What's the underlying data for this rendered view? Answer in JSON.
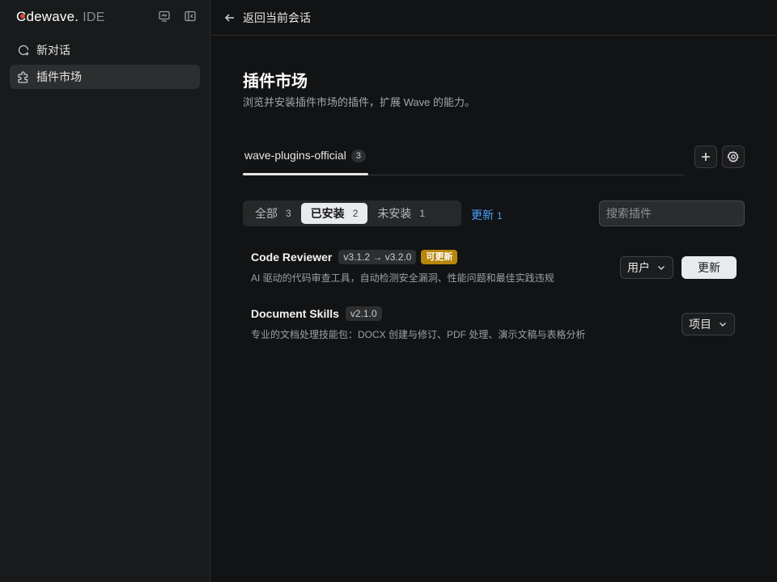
{
  "app": {
    "brand_first": "C",
    "brand_rest": "dewave.",
    "brand_suffix": "IDE",
    "accent_color": "#e0463b"
  },
  "sidebar": {
    "items": [
      {
        "label": "新对话",
        "icon": "new-chat-icon"
      },
      {
        "label": "插件市场",
        "icon": "plugin-icon"
      }
    ]
  },
  "topbar": {
    "back_label": "返回当前会话"
  },
  "main": {
    "title": "插件市场",
    "subtitle": "浏览并安装插件市场的插件，扩展 Wave 的能力。",
    "marketplace_tab": {
      "label": "wave-plugins-official",
      "count": "3"
    },
    "filters": [
      {
        "label": "全部",
        "count": "3"
      },
      {
        "label": "已安装",
        "count": "2"
      },
      {
        "label": "未安装",
        "count": "1"
      }
    ],
    "update_link": {
      "label": "更新",
      "count": "1"
    },
    "search_placeholder": "搜索插件"
  },
  "plugins": [
    {
      "name": "Code Reviewer",
      "version": "v3.1.2 → v3.2.0",
      "badge": "可更新",
      "description": "AI 驱动的代码审查工具，自动检测安全漏洞、性能问题和最佳实践违规",
      "scope": "用户",
      "action": "更新"
    },
    {
      "name": "Document Skills",
      "version": "v2.1.0",
      "description": "专业的文档处理技能包：DOCX 创建与修订、PDF 处理、演示文稿与表格分析",
      "scope": "项目"
    }
  ]
}
